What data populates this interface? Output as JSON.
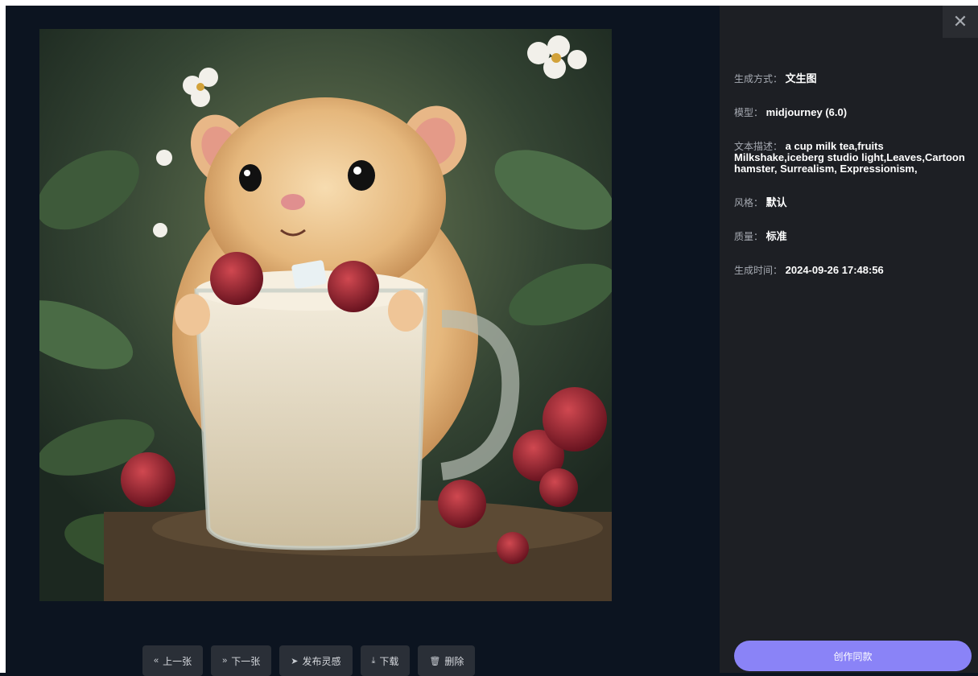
{
  "toolbar": {
    "prev": {
      "icon": "double-chevron-left-icon",
      "glyph": "«",
      "label": "上一张"
    },
    "next": {
      "icon": "double-chevron-right-icon",
      "glyph": "»",
      "label": "下一张"
    },
    "publish": {
      "icon": "send-icon",
      "glyph": "➤",
      "label": "发布灵感"
    },
    "download": {
      "icon": "download-icon",
      "glyph": "⤓",
      "label": "下载"
    },
    "delete": {
      "icon": "trash-icon",
      "glyph": "🗑",
      "label": "删除"
    }
  },
  "panel": {
    "close_glyph": "✕",
    "method": {
      "label": "生成方式：",
      "value": "文生图"
    },
    "model": {
      "label": "模型：",
      "value": "midjourney (6.0)"
    },
    "prompt": {
      "label": "文本描述：",
      "value": "a cup milk tea,fruits Milkshake,iceberg studio light,Leaves,Cartoon hamster, Surrealism, Expressionism,"
    },
    "style": {
      "label": "风格：",
      "value": "默认"
    },
    "quality": {
      "label": "质量：",
      "value": "标准"
    },
    "created": {
      "label": "生成时间：",
      "value": "2024-09-26 17:48:56"
    },
    "create_same_label": "创作同款"
  },
  "colors": {
    "viewer_bg": "#0c1420",
    "panel_bg": "#1d1f24",
    "accent": "#8a83f7",
    "button_bg": "#2a2f37"
  }
}
